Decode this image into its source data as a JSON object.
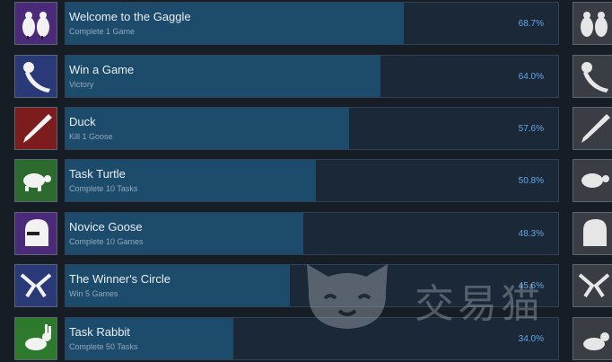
{
  "achievements": [
    {
      "title": "Welcome to the Gaggle",
      "desc": "Complete 1 Game",
      "pct_label": "68.7%",
      "pct": 68.7,
      "color": "#4b2a7a",
      "icon": "two-geese-icon"
    },
    {
      "title": "Win a Game",
      "desc": "Victory",
      "pct_label": "64.0%",
      "pct": 64.0,
      "color": "#2a3a78",
      "icon": "goose-ribbon-icon"
    },
    {
      "title": "Duck",
      "desc": "Kill 1 Goose",
      "pct_label": "57.6%",
      "pct": 57.6,
      "color": "#7d1c1c",
      "icon": "knife-icon"
    },
    {
      "title": "Task Turtle",
      "desc": "Complete 10 Tasks",
      "pct_label": "50.8%",
      "pct": 50.8,
      "color": "#2d6a2d",
      "icon": "turtle-icon"
    },
    {
      "title": "Novice Goose",
      "desc": "Complete 10 Games",
      "pct_label": "48.3%",
      "pct": 48.3,
      "color": "#4b2a7a",
      "icon": "helmet-goose-icon"
    },
    {
      "title": "The Winner's Circle",
      "desc": "Win 5 Games",
      "pct_label": "45.6%",
      "pct": 45.6,
      "color": "#2a3a78",
      "icon": "winners-circle-icon"
    },
    {
      "title": "Task Rabbit",
      "desc": "Complete 50 Tasks",
      "pct_label": "34.0%",
      "pct": 34.0,
      "color": "#2d7a2d",
      "icon": "rabbit-icon"
    }
  ],
  "watermark": {
    "text": "交易猫"
  }
}
